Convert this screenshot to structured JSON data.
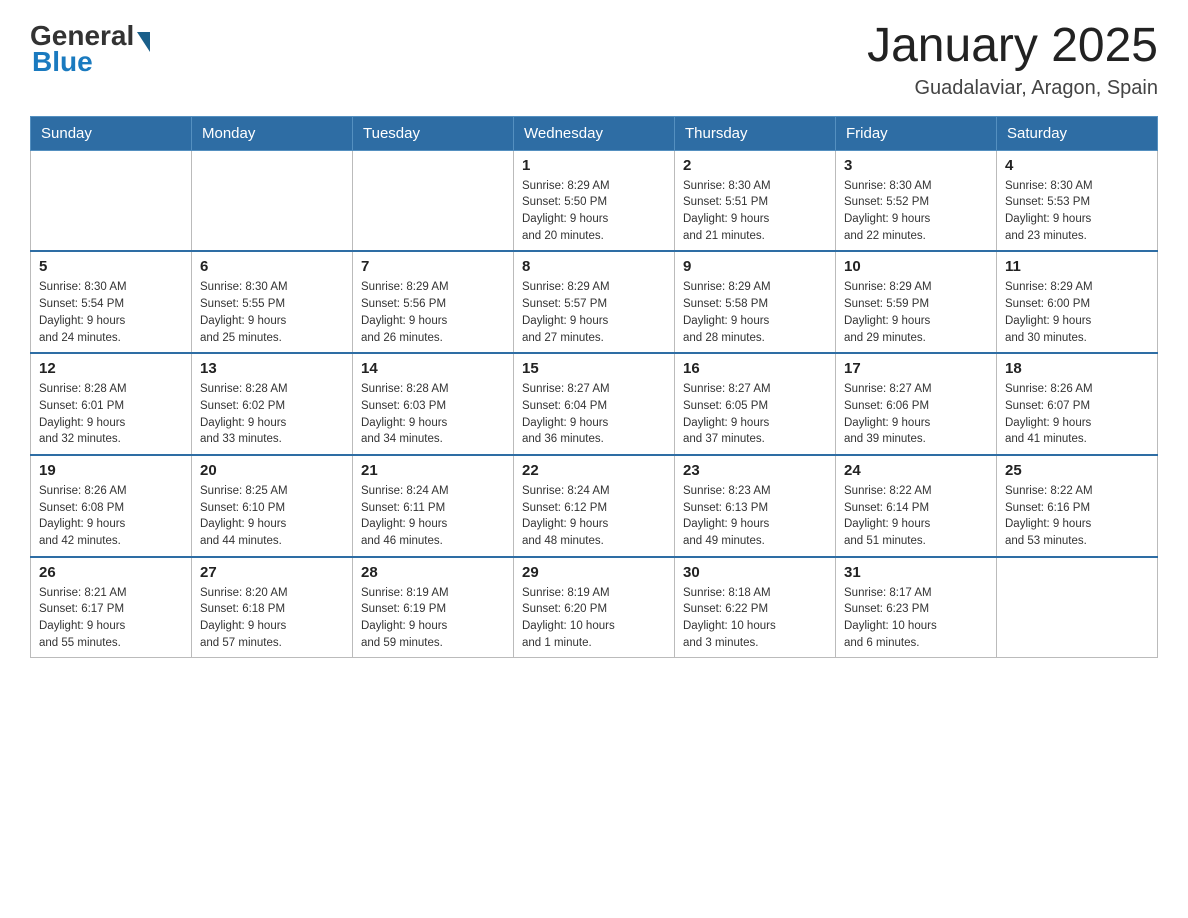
{
  "header": {
    "logo_general": "General",
    "logo_blue": "Blue",
    "month_title": "January 2025",
    "location": "Guadalaviar, Aragon, Spain"
  },
  "weekdays": [
    "Sunday",
    "Monday",
    "Tuesday",
    "Wednesday",
    "Thursday",
    "Friday",
    "Saturday"
  ],
  "weeks": [
    [
      {
        "day": "",
        "info": ""
      },
      {
        "day": "",
        "info": ""
      },
      {
        "day": "",
        "info": ""
      },
      {
        "day": "1",
        "info": "Sunrise: 8:29 AM\nSunset: 5:50 PM\nDaylight: 9 hours\nand 20 minutes."
      },
      {
        "day": "2",
        "info": "Sunrise: 8:30 AM\nSunset: 5:51 PM\nDaylight: 9 hours\nand 21 minutes."
      },
      {
        "day": "3",
        "info": "Sunrise: 8:30 AM\nSunset: 5:52 PM\nDaylight: 9 hours\nand 22 minutes."
      },
      {
        "day": "4",
        "info": "Sunrise: 8:30 AM\nSunset: 5:53 PM\nDaylight: 9 hours\nand 23 minutes."
      }
    ],
    [
      {
        "day": "5",
        "info": "Sunrise: 8:30 AM\nSunset: 5:54 PM\nDaylight: 9 hours\nand 24 minutes."
      },
      {
        "day": "6",
        "info": "Sunrise: 8:30 AM\nSunset: 5:55 PM\nDaylight: 9 hours\nand 25 minutes."
      },
      {
        "day": "7",
        "info": "Sunrise: 8:29 AM\nSunset: 5:56 PM\nDaylight: 9 hours\nand 26 minutes."
      },
      {
        "day": "8",
        "info": "Sunrise: 8:29 AM\nSunset: 5:57 PM\nDaylight: 9 hours\nand 27 minutes."
      },
      {
        "day": "9",
        "info": "Sunrise: 8:29 AM\nSunset: 5:58 PM\nDaylight: 9 hours\nand 28 minutes."
      },
      {
        "day": "10",
        "info": "Sunrise: 8:29 AM\nSunset: 5:59 PM\nDaylight: 9 hours\nand 29 minutes."
      },
      {
        "day": "11",
        "info": "Sunrise: 8:29 AM\nSunset: 6:00 PM\nDaylight: 9 hours\nand 30 minutes."
      }
    ],
    [
      {
        "day": "12",
        "info": "Sunrise: 8:28 AM\nSunset: 6:01 PM\nDaylight: 9 hours\nand 32 minutes."
      },
      {
        "day": "13",
        "info": "Sunrise: 8:28 AM\nSunset: 6:02 PM\nDaylight: 9 hours\nand 33 minutes."
      },
      {
        "day": "14",
        "info": "Sunrise: 8:28 AM\nSunset: 6:03 PM\nDaylight: 9 hours\nand 34 minutes."
      },
      {
        "day": "15",
        "info": "Sunrise: 8:27 AM\nSunset: 6:04 PM\nDaylight: 9 hours\nand 36 minutes."
      },
      {
        "day": "16",
        "info": "Sunrise: 8:27 AM\nSunset: 6:05 PM\nDaylight: 9 hours\nand 37 minutes."
      },
      {
        "day": "17",
        "info": "Sunrise: 8:27 AM\nSunset: 6:06 PM\nDaylight: 9 hours\nand 39 minutes."
      },
      {
        "day": "18",
        "info": "Sunrise: 8:26 AM\nSunset: 6:07 PM\nDaylight: 9 hours\nand 41 minutes."
      }
    ],
    [
      {
        "day": "19",
        "info": "Sunrise: 8:26 AM\nSunset: 6:08 PM\nDaylight: 9 hours\nand 42 minutes."
      },
      {
        "day": "20",
        "info": "Sunrise: 8:25 AM\nSunset: 6:10 PM\nDaylight: 9 hours\nand 44 minutes."
      },
      {
        "day": "21",
        "info": "Sunrise: 8:24 AM\nSunset: 6:11 PM\nDaylight: 9 hours\nand 46 minutes."
      },
      {
        "day": "22",
        "info": "Sunrise: 8:24 AM\nSunset: 6:12 PM\nDaylight: 9 hours\nand 48 minutes."
      },
      {
        "day": "23",
        "info": "Sunrise: 8:23 AM\nSunset: 6:13 PM\nDaylight: 9 hours\nand 49 minutes."
      },
      {
        "day": "24",
        "info": "Sunrise: 8:22 AM\nSunset: 6:14 PM\nDaylight: 9 hours\nand 51 minutes."
      },
      {
        "day": "25",
        "info": "Sunrise: 8:22 AM\nSunset: 6:16 PM\nDaylight: 9 hours\nand 53 minutes."
      }
    ],
    [
      {
        "day": "26",
        "info": "Sunrise: 8:21 AM\nSunset: 6:17 PM\nDaylight: 9 hours\nand 55 minutes."
      },
      {
        "day": "27",
        "info": "Sunrise: 8:20 AM\nSunset: 6:18 PM\nDaylight: 9 hours\nand 57 minutes."
      },
      {
        "day": "28",
        "info": "Sunrise: 8:19 AM\nSunset: 6:19 PM\nDaylight: 9 hours\nand 59 minutes."
      },
      {
        "day": "29",
        "info": "Sunrise: 8:19 AM\nSunset: 6:20 PM\nDaylight: 10 hours\nand 1 minute."
      },
      {
        "day": "30",
        "info": "Sunrise: 8:18 AM\nSunset: 6:22 PM\nDaylight: 10 hours\nand 3 minutes."
      },
      {
        "day": "31",
        "info": "Sunrise: 8:17 AM\nSunset: 6:23 PM\nDaylight: 10 hours\nand 6 minutes."
      },
      {
        "day": "",
        "info": ""
      }
    ]
  ]
}
